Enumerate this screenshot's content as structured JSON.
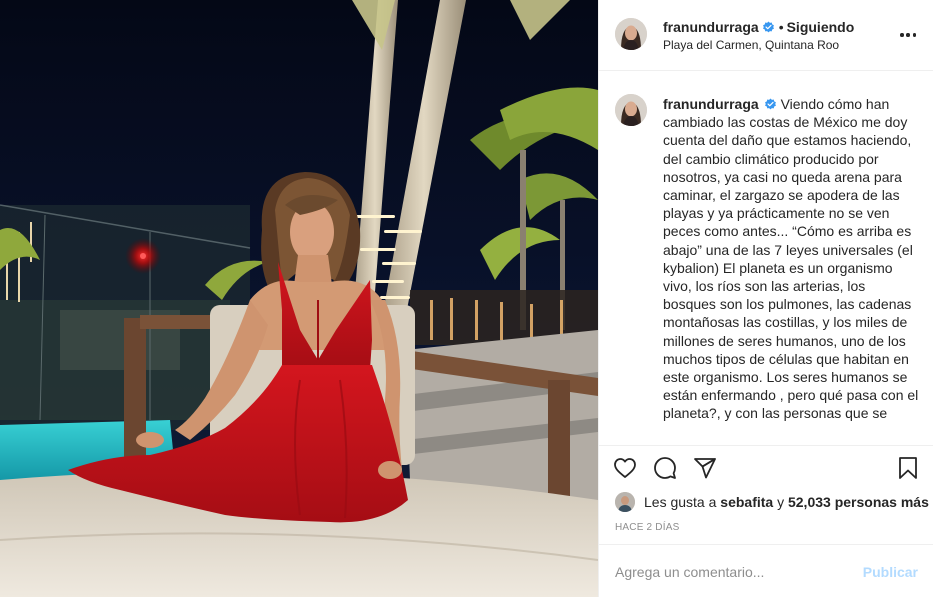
{
  "post": {
    "username": "franundurraga",
    "following_label": "Siguiendo",
    "separator": "•",
    "location": "Playa del Carmen, Quintana Roo",
    "more_icon": "ellipsis-icon",
    "verified_icon": "verified-badge-icon"
  },
  "caption": {
    "username": "franundurraga",
    "text": "Viendo cómo han cambiado las costas de México me doy cuenta del daño que estamos haciendo, del cambio climático producido por nosotros, ya casi no queda arena para caminar, el zargazo se apodera de las playas y ya prácticamente no se ven peces como antes... “Cómo es arriba es abajo” una de las 7 leyes universales (el kybalion) El planeta es un organismo vivo, los ríos son las arterias, los bosques son los pulmones, las cadenas montañosas las costillas, y los miles de millones de seres humanos, uno de los muchos tipos de células que habitan en este organismo. Los seres humanos se están enfermando , pero qué pasa con el planeta?, y con las personas que se"
  },
  "actions": {
    "like_icon": "heart-icon",
    "comment_icon": "comment-bubble-icon",
    "share_icon": "paper-plane-icon",
    "save_icon": "bookmark-icon"
  },
  "likes": {
    "prefix": "Les gusta a",
    "first_user": "sebafita",
    "connector": "y",
    "others": "52,033 personas más"
  },
  "timestamp": "Hace 2 días",
  "comment": {
    "placeholder": "Agrega un comentario...",
    "publish_label": "Publicar"
  },
  "colors": {
    "text": "#262626",
    "muted": "#8e8e8e",
    "border": "#efefef",
    "verified": "#3897f0",
    "publish_disabled": "#b3dbff",
    "dress": "#c8141c"
  }
}
